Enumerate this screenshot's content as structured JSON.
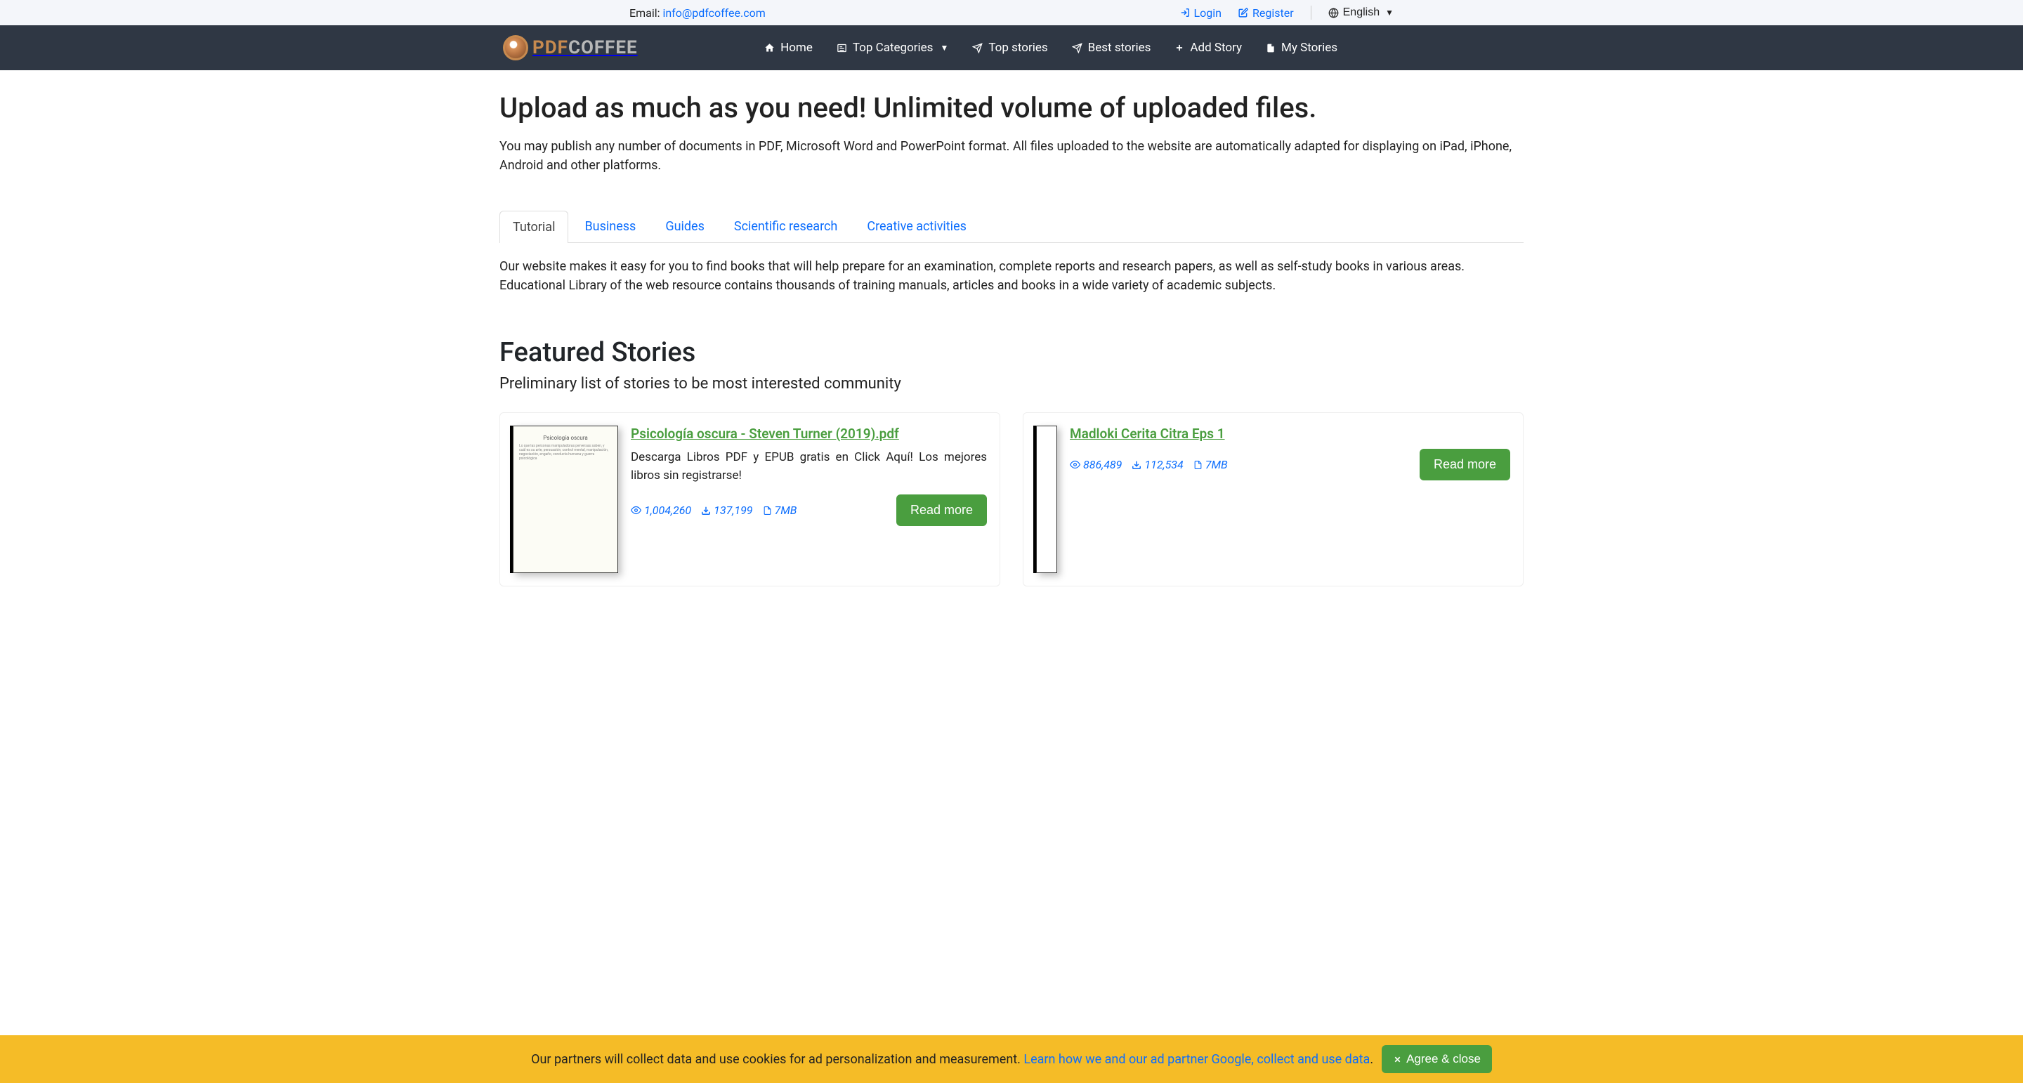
{
  "topbar": {
    "email_label": "Email: ",
    "email": "info@pdfcoffee.com",
    "login": "Login",
    "register": "Register",
    "language": "English"
  },
  "logo": {
    "pdf": "PDF",
    "coffee": "COFFEE"
  },
  "nav": {
    "home": "Home",
    "top_categories": "Top Categories",
    "top_stories": "Top stories",
    "best_stories": "Best stories",
    "add_story": "Add Story",
    "my_stories": "My Stories"
  },
  "hero": {
    "title": "Upload as much as you need! Unlimited volume of uploaded files.",
    "sub": "You may publish any number of documents in PDF, Microsoft Word and PowerPoint format. All files uploaded to the website are automatically adapted for displaying on iPad, iPhone, Android and other platforms."
  },
  "tabs": {
    "items": [
      {
        "label": "Tutorial",
        "active": true
      },
      {
        "label": "Business",
        "active": false
      },
      {
        "label": "Guides",
        "active": false
      },
      {
        "label": "Scientific research",
        "active": false
      },
      {
        "label": "Creative activities",
        "active": false
      }
    ],
    "content": "Our website makes it easy for you to find books that will help prepare for an examination, complete reports and research papers, as well as self-study books in various areas. Educational Library of the web resource contains thousands of training manuals, articles and books in a wide variety of academic subjects."
  },
  "featured": {
    "title": "Featured Stories",
    "sub": "Preliminary list of stories to be most interested community"
  },
  "stories": [
    {
      "title": "Psicología oscura - Steven Turner (2019).pdf",
      "desc": "Descarga Libros PDF y EPUB gratis en Click Aquí! Los mejores libros sin registrarse!",
      "views": "1,004,260",
      "downloads": "137,199",
      "size": "7MB",
      "read_more": "Read more",
      "thumb_title": "Psicología oscura"
    },
    {
      "title": "Madloki Cerita Citra Eps 1",
      "desc": "",
      "views": "886,489",
      "downloads": "112,534",
      "size": "7MB",
      "read_more": "Read more"
    }
  ],
  "cookie": {
    "text": "Our partners will collect data and use cookies for ad personalization and measurement. ",
    "link": "Learn how we and our ad partner Google, collect and use data",
    "dot": ".",
    "agree": "Agree & close"
  }
}
